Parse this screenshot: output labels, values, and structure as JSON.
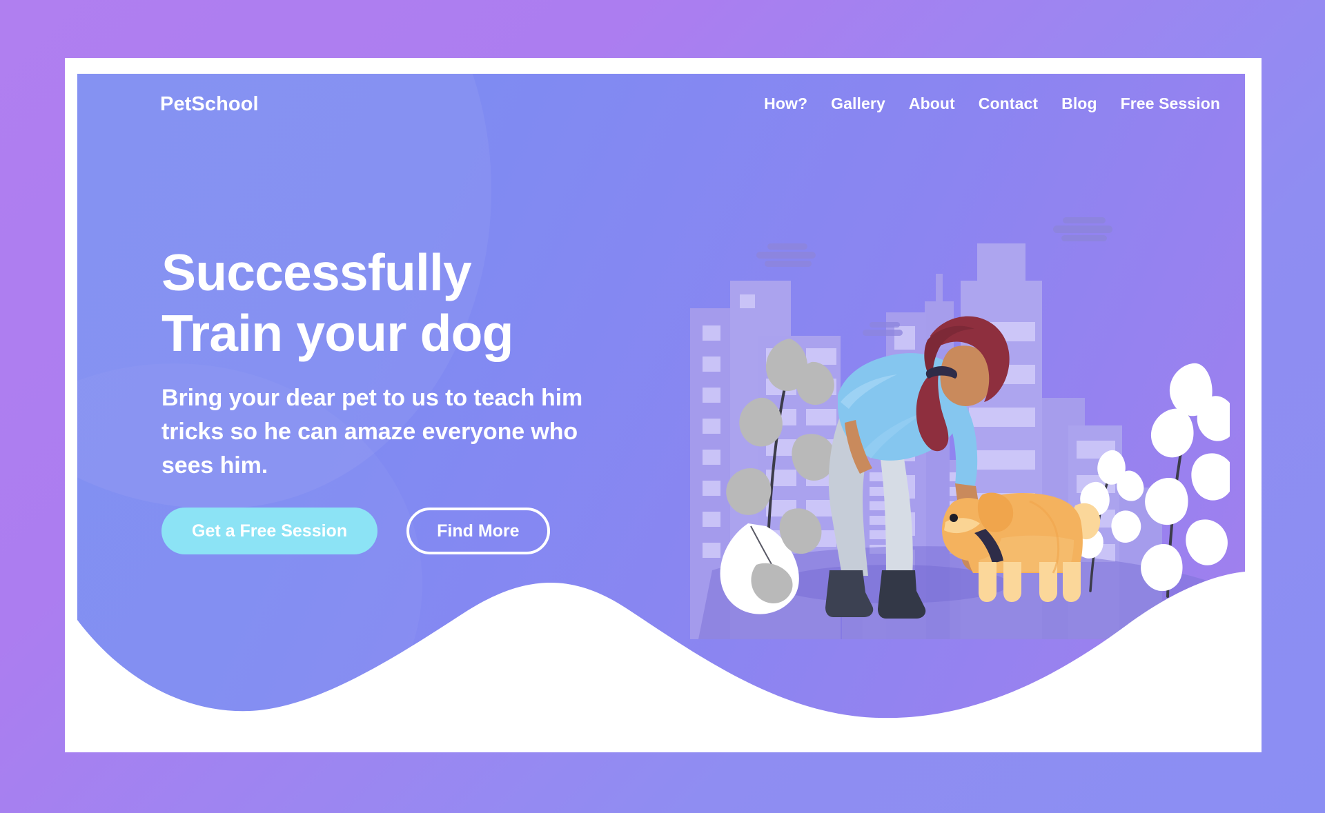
{
  "page": {
    "title": "PetSchool",
    "colors": {
      "outer_background_start": "#b07ff0",
      "outer_background_end": "#8b8ef3",
      "frame": "#ffffff",
      "card_start": "#7e8cf2",
      "card_end": "#a37fee",
      "primary_button": "#8ce3f5",
      "text": "#ffffff",
      "wave": "#ffffff",
      "building_light": "#a9a0ee",
      "building_lighter": "#c4bdf5",
      "ground_shadow": "#7b6fd6",
      "dog_body": "#f4b25e",
      "dog_paw": "#fbd79a",
      "shirt": "#85c6ef",
      "pants": "#c6cdd8",
      "hair": "#8e2f3e",
      "skin": "#c98a5c",
      "boots": "#3c4152",
      "leaf_white": "#ffffff",
      "leaf_grey": "#b9b9b9",
      "stem": "#3c3c4a"
    }
  },
  "header": {
    "brand": "PetSchool",
    "nav": [
      {
        "label": "How?",
        "name": "nav-item-how"
      },
      {
        "label": "Gallery",
        "name": "nav-item-gallery"
      },
      {
        "label": "About",
        "name": "nav-item-about"
      },
      {
        "label": "Contact",
        "name": "nav-item-contact"
      },
      {
        "label": "Blog",
        "name": "nav-item-blog"
      },
      {
        "label": "Free Session",
        "name": "nav-item-free-session"
      }
    ]
  },
  "hero": {
    "headline_line1": "Successfully",
    "headline_line2": "Train your dog",
    "subcopy": "Bring your dear pet to us to teach him tricks so he can amaze everyone who sees him.",
    "primary_button": "Get a Free Session",
    "secondary_button": "Find More"
  },
  "illustration": {
    "alt": "Woman bending down petting a golden dog in front of a purple city skyline with leafy plants",
    "elements": [
      "city-skyline",
      "cloud-left",
      "cloud-right",
      "woman-with-ponytail",
      "golden-dog",
      "grey-leaf-plant",
      "white-leaf-plant-large",
      "white-leaf-plant-small",
      "ground-shadow"
    ]
  }
}
